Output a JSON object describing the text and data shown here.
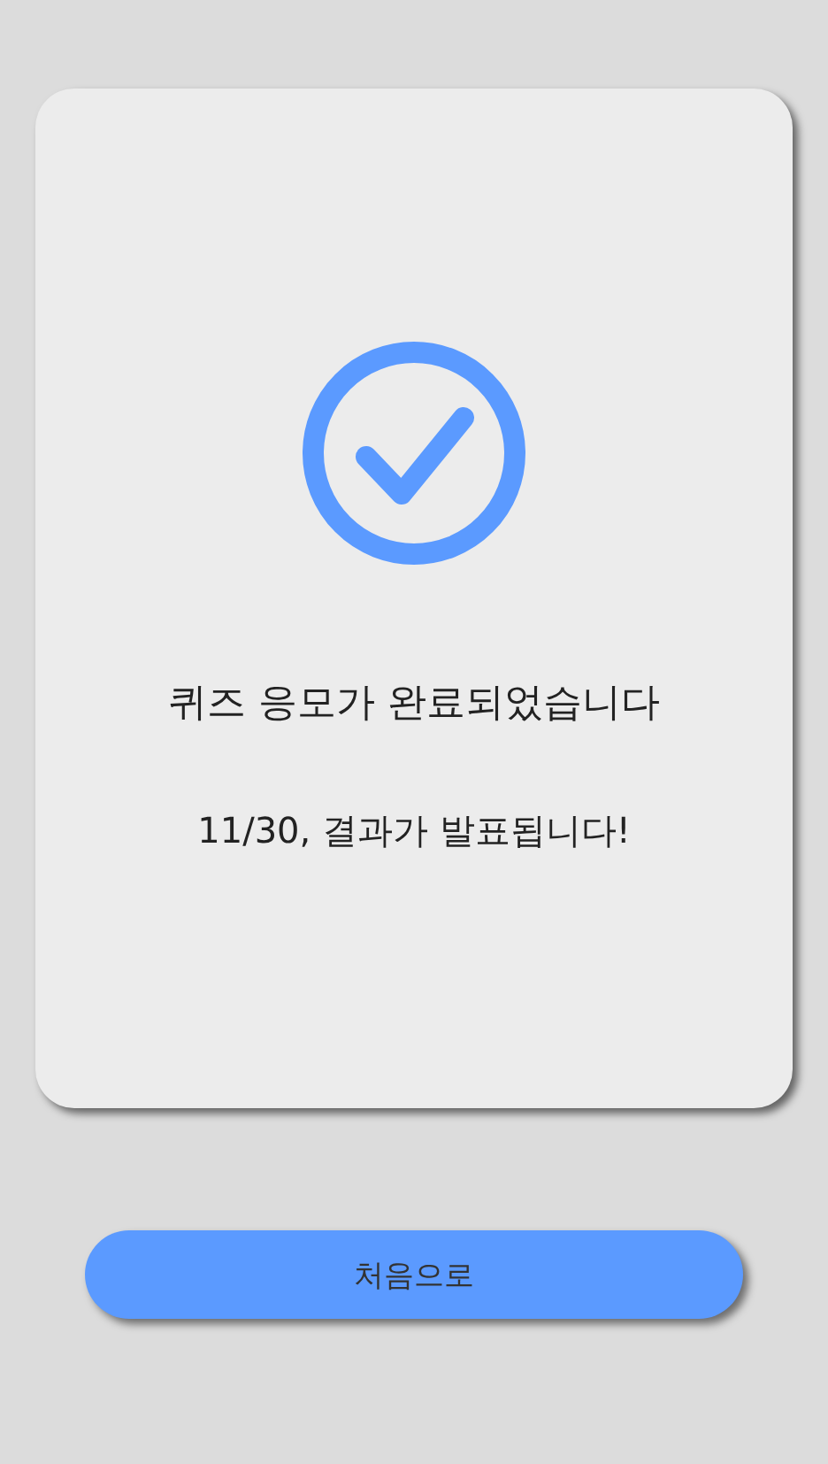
{
  "card": {
    "title": "퀴즈 응모가 완료되었습니다",
    "message": "11/30, 결과가 발표됩니다!"
  },
  "buttons": [
    {
      "label": "처음으로"
    }
  ]
}
